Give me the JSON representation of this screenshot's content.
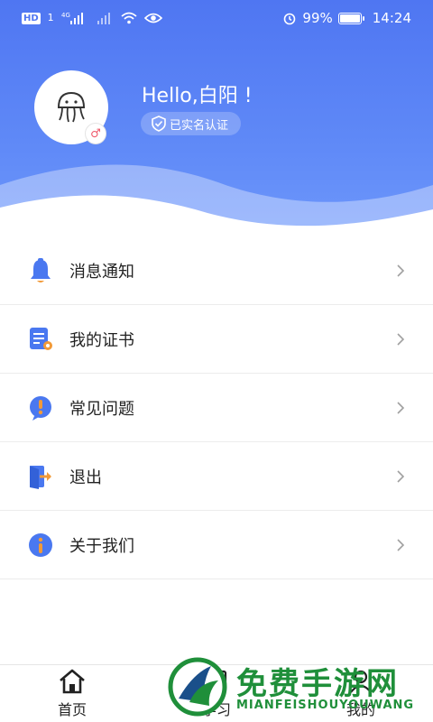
{
  "status_bar": {
    "left_badge_hd": "HD",
    "left_sim1": "1",
    "left_network": "4G",
    "right_battery": "99%",
    "right_time": "14:24"
  },
  "profile": {
    "greeting": "Hello,白阳 !",
    "verified_label": "已实名认证",
    "gender_symbol": "♂"
  },
  "menu": {
    "items": [
      {
        "label": "消息通知",
        "icon": "bell-icon",
        "color": "#4a78f0"
      },
      {
        "label": "我的证书",
        "icon": "certificate-icon",
        "color": "#4a78f0"
      },
      {
        "label": "常见问题",
        "icon": "question-icon",
        "color": "#4a78f0"
      },
      {
        "label": "退出",
        "icon": "logout-icon",
        "color": "#f29a38"
      },
      {
        "label": "关于我们",
        "icon": "info-icon",
        "color": "#4a78f0"
      }
    ]
  },
  "tabbar": {
    "tabs": [
      {
        "label": "首页",
        "icon": "home-icon"
      },
      {
        "label": "学习",
        "icon": "study-icon"
      },
      {
        "label": "我的",
        "icon": "user-icon"
      }
    ]
  },
  "watermark": {
    "title": "免费手游网",
    "subtitle": "MIANFEISHOUYOUWANG"
  },
  "theme": {
    "header_blue": "#4f76f2",
    "accent_orange": "#f29a38",
    "watermark_green": "#1f8f3a"
  }
}
